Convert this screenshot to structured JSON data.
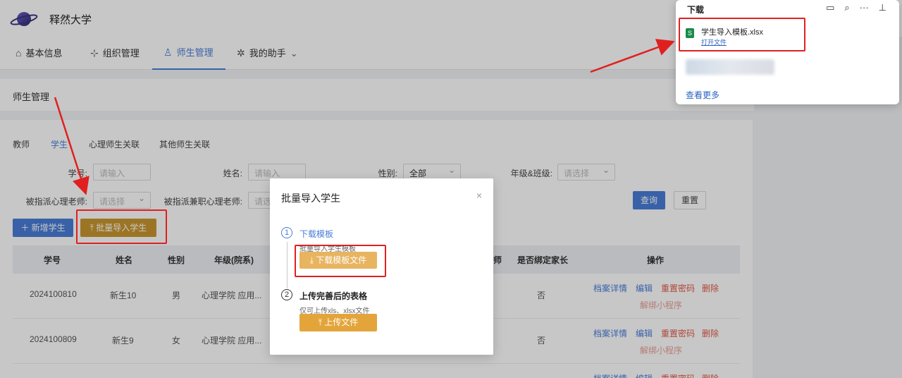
{
  "brand": {
    "name": "释然大学"
  },
  "nav": [
    {
      "label": "基本信息",
      "icon": "home-icon",
      "glyph": "⌂"
    },
    {
      "label": "组织管理",
      "icon": "org-icon",
      "glyph": "⊹"
    },
    {
      "label": "师生管理",
      "icon": "user-icon",
      "glyph": "♙"
    },
    {
      "label": "我的助手",
      "icon": "assistant-icon",
      "glyph": "✲",
      "chevron": "⌄"
    }
  ],
  "breadcrumb": "师生管理",
  "tabs": [
    "教师",
    "学生",
    "心理师生关联",
    "其他师生关联"
  ],
  "filters": {
    "student_id": {
      "label": "学号:",
      "placeholder": "请输入"
    },
    "name": {
      "label": "姓名:",
      "placeholder": "请输入"
    },
    "gender": {
      "label": "性别:",
      "value": "全部"
    },
    "grade_class": {
      "label": "年级&班级:",
      "placeholder": "请选择"
    },
    "assigned_counselor": {
      "label": "被指派心理老师:",
      "placeholder": "请选择"
    },
    "assigned_parttime": {
      "label": "被指派兼职心理老师:",
      "placeholder": "请选"
    }
  },
  "buttons": {
    "query": "查询",
    "reset": "重置",
    "add_student": "＋ 新增学生",
    "batch_import": "⤒ 批量导入学生"
  },
  "table": {
    "headers": [
      "学号",
      "姓名",
      "性别",
      "年级(院系)",
      "师",
      "是否绑定家长",
      "操作"
    ],
    "rows": [
      {
        "id": "2024100810",
        "name": "新生10",
        "gender": "男",
        "grade": "心理学院 应用...",
        "bound": "否"
      },
      {
        "id": "2024100809",
        "name": "新生9",
        "gender": "女",
        "grade": "心理学院 应用...",
        "bound": "否"
      }
    ],
    "ops": {
      "detail": "档案详情",
      "edit": "编辑",
      "reset_pwd": "重置密码",
      "delete": "删除",
      "unbind": "解绑小程序"
    }
  },
  "modal": {
    "title": "批量导入学生",
    "close": "×",
    "step1": {
      "num": "1",
      "title": "下载模板",
      "desc": "批量导入学生模板",
      "button": "⤓  下载模板文件"
    },
    "step2": {
      "num": "2",
      "title": "上传完善后的表格",
      "desc": "仅可上传xls、xlsx文件",
      "button": "⤒  上传文件"
    }
  },
  "downloads": {
    "title": "下载",
    "tools": {
      "folder": "▭",
      "search": "⌕",
      "more": "···",
      "pin": "⊥"
    },
    "file": {
      "icon_letter": "S",
      "name": "学生导入模板.xlsx",
      "action": "打开文件"
    },
    "see_more": "查看更多"
  },
  "colors": {
    "primary": "#4a7dd8",
    "gold": "#c8972f",
    "download_btn": "#e8b460",
    "annotation": "#e02020"
  }
}
